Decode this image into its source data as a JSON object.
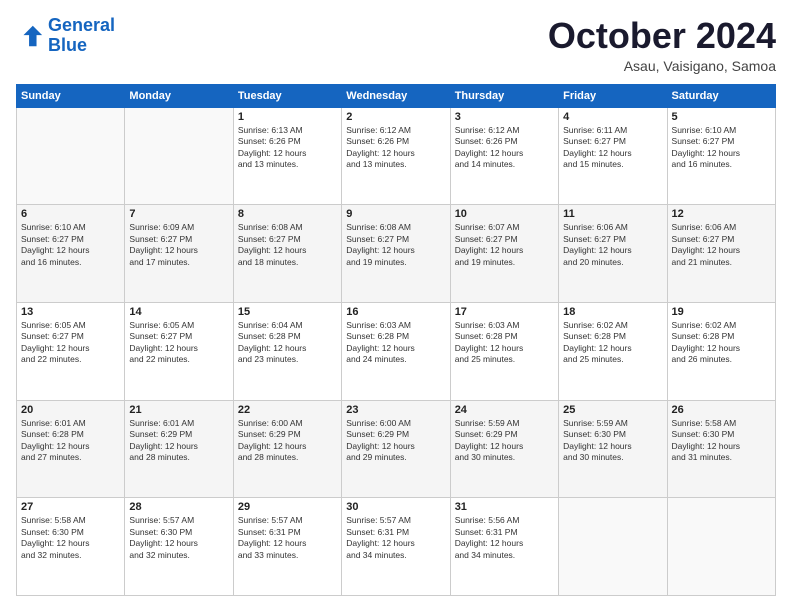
{
  "logo": {
    "line1": "General",
    "line2": "Blue"
  },
  "title": "October 2024",
  "location": "Asau, Vaisigano, Samoa",
  "days_header": [
    "Sunday",
    "Monday",
    "Tuesday",
    "Wednesday",
    "Thursday",
    "Friday",
    "Saturday"
  ],
  "weeks": [
    [
      {
        "day": "",
        "info": ""
      },
      {
        "day": "",
        "info": ""
      },
      {
        "day": "1",
        "info": "Sunrise: 6:13 AM\nSunset: 6:26 PM\nDaylight: 12 hours\nand 13 minutes."
      },
      {
        "day": "2",
        "info": "Sunrise: 6:12 AM\nSunset: 6:26 PM\nDaylight: 12 hours\nand 13 minutes."
      },
      {
        "day": "3",
        "info": "Sunrise: 6:12 AM\nSunset: 6:26 PM\nDaylight: 12 hours\nand 14 minutes."
      },
      {
        "day": "4",
        "info": "Sunrise: 6:11 AM\nSunset: 6:27 PM\nDaylight: 12 hours\nand 15 minutes."
      },
      {
        "day": "5",
        "info": "Sunrise: 6:10 AM\nSunset: 6:27 PM\nDaylight: 12 hours\nand 16 minutes."
      }
    ],
    [
      {
        "day": "6",
        "info": "Sunrise: 6:10 AM\nSunset: 6:27 PM\nDaylight: 12 hours\nand 16 minutes."
      },
      {
        "day": "7",
        "info": "Sunrise: 6:09 AM\nSunset: 6:27 PM\nDaylight: 12 hours\nand 17 minutes."
      },
      {
        "day": "8",
        "info": "Sunrise: 6:08 AM\nSunset: 6:27 PM\nDaylight: 12 hours\nand 18 minutes."
      },
      {
        "day": "9",
        "info": "Sunrise: 6:08 AM\nSunset: 6:27 PM\nDaylight: 12 hours\nand 19 minutes."
      },
      {
        "day": "10",
        "info": "Sunrise: 6:07 AM\nSunset: 6:27 PM\nDaylight: 12 hours\nand 19 minutes."
      },
      {
        "day": "11",
        "info": "Sunrise: 6:06 AM\nSunset: 6:27 PM\nDaylight: 12 hours\nand 20 minutes."
      },
      {
        "day": "12",
        "info": "Sunrise: 6:06 AM\nSunset: 6:27 PM\nDaylight: 12 hours\nand 21 minutes."
      }
    ],
    [
      {
        "day": "13",
        "info": "Sunrise: 6:05 AM\nSunset: 6:27 PM\nDaylight: 12 hours\nand 22 minutes."
      },
      {
        "day": "14",
        "info": "Sunrise: 6:05 AM\nSunset: 6:27 PM\nDaylight: 12 hours\nand 22 minutes."
      },
      {
        "day": "15",
        "info": "Sunrise: 6:04 AM\nSunset: 6:28 PM\nDaylight: 12 hours\nand 23 minutes."
      },
      {
        "day": "16",
        "info": "Sunrise: 6:03 AM\nSunset: 6:28 PM\nDaylight: 12 hours\nand 24 minutes."
      },
      {
        "day": "17",
        "info": "Sunrise: 6:03 AM\nSunset: 6:28 PM\nDaylight: 12 hours\nand 25 minutes."
      },
      {
        "day": "18",
        "info": "Sunrise: 6:02 AM\nSunset: 6:28 PM\nDaylight: 12 hours\nand 25 minutes."
      },
      {
        "day": "19",
        "info": "Sunrise: 6:02 AM\nSunset: 6:28 PM\nDaylight: 12 hours\nand 26 minutes."
      }
    ],
    [
      {
        "day": "20",
        "info": "Sunrise: 6:01 AM\nSunset: 6:28 PM\nDaylight: 12 hours\nand 27 minutes."
      },
      {
        "day": "21",
        "info": "Sunrise: 6:01 AM\nSunset: 6:29 PM\nDaylight: 12 hours\nand 28 minutes."
      },
      {
        "day": "22",
        "info": "Sunrise: 6:00 AM\nSunset: 6:29 PM\nDaylight: 12 hours\nand 28 minutes."
      },
      {
        "day": "23",
        "info": "Sunrise: 6:00 AM\nSunset: 6:29 PM\nDaylight: 12 hours\nand 29 minutes."
      },
      {
        "day": "24",
        "info": "Sunrise: 5:59 AM\nSunset: 6:29 PM\nDaylight: 12 hours\nand 30 minutes."
      },
      {
        "day": "25",
        "info": "Sunrise: 5:59 AM\nSunset: 6:30 PM\nDaylight: 12 hours\nand 30 minutes."
      },
      {
        "day": "26",
        "info": "Sunrise: 5:58 AM\nSunset: 6:30 PM\nDaylight: 12 hours\nand 31 minutes."
      }
    ],
    [
      {
        "day": "27",
        "info": "Sunrise: 5:58 AM\nSunset: 6:30 PM\nDaylight: 12 hours\nand 32 minutes."
      },
      {
        "day": "28",
        "info": "Sunrise: 5:57 AM\nSunset: 6:30 PM\nDaylight: 12 hours\nand 32 minutes."
      },
      {
        "day": "29",
        "info": "Sunrise: 5:57 AM\nSunset: 6:31 PM\nDaylight: 12 hours\nand 33 minutes."
      },
      {
        "day": "30",
        "info": "Sunrise: 5:57 AM\nSunset: 6:31 PM\nDaylight: 12 hours\nand 34 minutes."
      },
      {
        "day": "31",
        "info": "Sunrise: 5:56 AM\nSunset: 6:31 PM\nDaylight: 12 hours\nand 34 minutes."
      },
      {
        "day": "",
        "info": ""
      },
      {
        "day": "",
        "info": ""
      }
    ]
  ]
}
